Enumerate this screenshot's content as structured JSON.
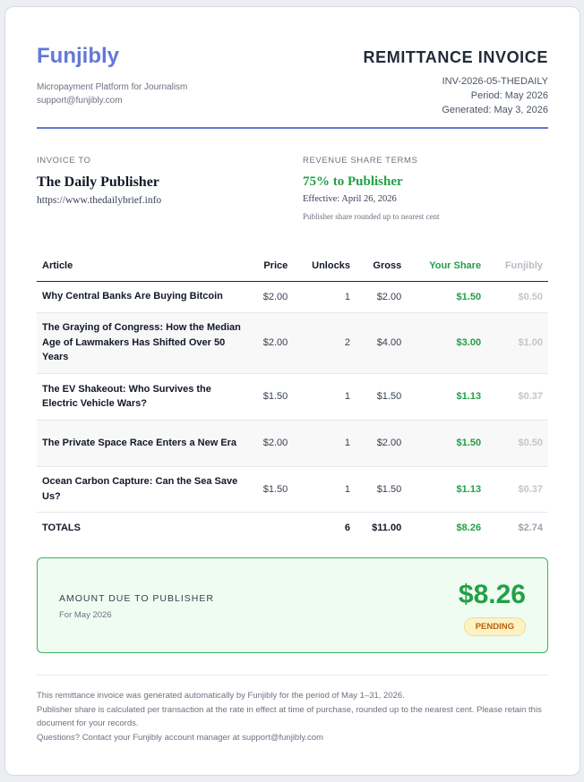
{
  "brand": {
    "name": "Funjibly",
    "tagline": "Micropayment Platform for Journalism",
    "email": "support@funjibly.com"
  },
  "invoice": {
    "title": "REMITTANCE INVOICE",
    "number": "INV-2026-05-THEDAILY",
    "period": "Period: May 2026",
    "generated": "Generated: May 3, 2026"
  },
  "invoice_to": {
    "label": "INVOICE TO",
    "name": "The Daily Publisher",
    "url": "https://www.thedailybrief.info"
  },
  "terms": {
    "label": "REVENUE SHARE TERMS",
    "share": "75% to Publisher",
    "effective": "Effective: April 26, 2026",
    "note": "Publisher share rounded up to nearest cent"
  },
  "colors": {
    "accent": "#6378d6",
    "green": "#22a046",
    "pending": "#b7620d"
  },
  "table": {
    "headers": [
      "Article",
      "Price",
      "Unlocks",
      "Gross",
      "Your Share",
      "Funjibly"
    ],
    "rows": [
      {
        "article": "Why Central Banks Are Buying Bitcoin",
        "price": "$2.00",
        "unlocks": "1",
        "gross": "$2.00",
        "share": "$1.50",
        "fee": "$0.50"
      },
      {
        "article": "The Graying of Congress: How the Median Age of Lawmakers Has Shifted Over 50 Years",
        "price": "$2.00",
        "unlocks": "2",
        "gross": "$4.00",
        "share": "$3.00",
        "fee": "$1.00"
      },
      {
        "article": "The EV Shakeout: Who Survives the Electric Vehicle Wars?",
        "price": "$1.50",
        "unlocks": "1",
        "gross": "$1.50",
        "share": "$1.13",
        "fee": "$0.37"
      },
      {
        "article": "The Private Space Race Enters a New Era",
        "price": "$2.00",
        "unlocks": "1",
        "gross": "$2.00",
        "share": "$1.50",
        "fee": "$0.50"
      },
      {
        "article": "Ocean Carbon Capture: Can the Sea Save Us?",
        "price": "$1.50",
        "unlocks": "1",
        "gross": "$1.50",
        "share": "$1.13",
        "fee": "$0.37"
      }
    ],
    "totals": {
      "label": "TOTALS",
      "unlocks": "6",
      "gross": "$11.00",
      "share": "$8.26",
      "fee": "$2.74"
    }
  },
  "amount_due": {
    "label": "AMOUNT DUE TO PUBLISHER",
    "period": "For May 2026",
    "amount": "$8.26",
    "status": "PENDING"
  },
  "footer": {
    "line1": "This remittance invoice was generated automatically by Funjibly for the period of May 1–31, 2026.",
    "line2": "Publisher share is calculated per transaction at the rate in effect at time of purchase, rounded up to the nearest cent. Please retain this document for your records.",
    "line3": "Questions? Contact your Funjibly account manager at support@funjibly.com"
  }
}
